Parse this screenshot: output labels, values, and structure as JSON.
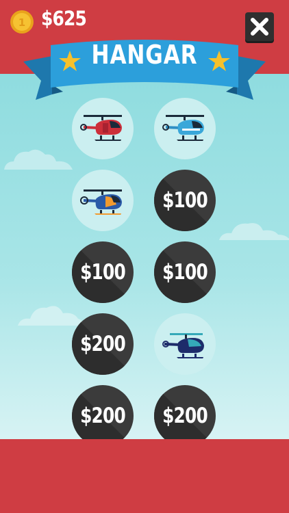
{
  "header": {
    "coin_icon": "coin-icon",
    "coin_symbol": "1",
    "money": "$625",
    "close_icon": "close-icon"
  },
  "banner": {
    "title": "HANGAR",
    "star_icon": "star-icon"
  },
  "colors": {
    "header_red": "#cf3d43",
    "banner_blue": "#2c9fdb",
    "locked_slot": "#3b3b3b",
    "unlocked_slot": "#cbeff0",
    "star_yellow": "#f7c12b"
  },
  "hangar": {
    "slots": [
      {
        "state": "owned",
        "icon": "red-helicopter-icon"
      },
      {
        "state": "owned",
        "icon": "blue-helicopter-icon"
      },
      {
        "state": "owned",
        "icon": "orange-blue-helicopter-icon"
      },
      {
        "state": "locked",
        "price": "$100"
      },
      {
        "state": "locked",
        "price": "$100"
      },
      {
        "state": "locked",
        "price": "$100"
      },
      {
        "state": "locked",
        "price": "$200"
      },
      {
        "state": "owned",
        "icon": "navy-teal-helicopter-icon"
      },
      {
        "state": "locked",
        "price": "$200"
      },
      {
        "state": "locked",
        "price": "$200"
      }
    ]
  }
}
